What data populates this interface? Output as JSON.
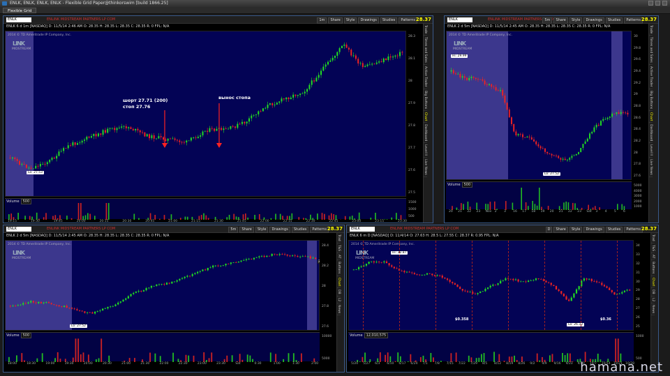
{
  "window": {
    "title": "ENLK, ENLK, ENLK, ENLK - Flexible Grid Paper@thinkorswim [build 1866.25]",
    "tab": "Flexible Grid"
  },
  "common": {
    "btn_share": "Share",
    "btn_style": "Style",
    "btn_drawings": "Drawings",
    "btn_studies": "Studies",
    "btn_patterns": "Patterns",
    "desc": "ENLINK MIDSTREAM PARTNERS LP COM",
    "watermark": "2014 © TD Ameritrade IP Company, Inc.",
    "logo": "LINK",
    "logo_sub": "MIDSTREAM",
    "vol_label": "Volume"
  },
  "panels": [
    {
      "symbol": "ENLK",
      "timeframe": "1m",
      "price": "28.37",
      "info": "ENLK 6 d 1m [NASDAQ]  D: 11/5/14 2:46 AM  O: 28.35  H: 28.35  L: 28.35  C: 28.35  R: 0  FPL: N/A",
      "low_label": "Lo: 27.53",
      "vol_value": "500",
      "xticks": [
        "19:15",
        "19:30",
        "19:45",
        "20:00",
        "20:15",
        "20:30",
        "20:45",
        "21:00",
        "21:15",
        "21:30",
        "21:45",
        "22:00",
        "22:15",
        "22:30",
        "22:45",
        "23:00",
        "23:15",
        "23:30"
      ],
      "yticks": [
        "28.3",
        "28.1",
        "28",
        "27.9",
        "27.8",
        "27.7",
        "27.6",
        "27.5"
      ],
      "vyticks": [
        "1500",
        "1000",
        "500"
      ],
      "sidetabs": [
        "Trade",
        "Times and Sales",
        "Active Trader",
        "Big Buttons",
        "Chart",
        "Dashboard",
        "Level II",
        "Live News"
      ],
      "annotation_short": "шорт 27.71 (200)",
      "annotation_stop": "стоп 27.76",
      "annotation_move": "вынос стопа"
    },
    {
      "symbol": "ENLK",
      "timeframe": "5m",
      "price": "28.37",
      "info": "ENLK 2 d 5m [NASDAQ]  D: 11/5/14 2:45 AM  O: 28.35  H: 28.35  L: 28.35  C: 28.35  R: 0  FPL: N/A",
      "high_label": "Hi: 29.99",
      "low_label": "Lo: 27.52",
      "vol_value": "500",
      "xticks": [
        "20",
        "21",
        "22",
        "23",
        "Nov",
        "2",
        "3",
        "16",
        "17",
        "18",
        "19",
        "20",
        "21",
        "22",
        "23",
        "Sat",
        "3",
        "4",
        "5",
        "6"
      ],
      "yticks": [
        "30",
        "29.8",
        "29.6",
        "29.4",
        "29.2",
        "29",
        "28.8",
        "28.6",
        "28.4",
        "28.2",
        "28",
        "27.8",
        "27.6"
      ],
      "vyticks": [
        "5000",
        "4000",
        "3000",
        "2000",
        "1000"
      ],
      "sidetabs": [
        "Trade",
        "Times and Sales",
        "Active Trader",
        "Big Buttons",
        "Chart",
        "Dashboard",
        "Level II",
        "Live News"
      ]
    },
    {
      "symbol": "ENLK",
      "timeframe": "5m",
      "price": "28.37",
      "info": "ENLK 2 d 5m [NASDAQ]  D: 11/5/14 2:45 AM  O: 28.35  H: 28.35  L: 28.35  C: 28.35  R: 0  FPL: N/A",
      "low_label": "Lo: 27.52",
      "price_tag": "28.35",
      "vol_value": "500",
      "xticks": [
        "18:00",
        "18:30",
        "19:00",
        "19:30",
        "20:00",
        "20:30",
        "21:00",
        "21:30",
        "22:00",
        "22:30",
        "23:00",
        "23:30",
        "Sat",
        "0:30",
        "1:00",
        "1:30",
        "2:00"
      ],
      "yticks": [
        "28.4",
        "28.2",
        "28",
        "27.8",
        "27.6"
      ],
      "vyticks": [
        "10000",
        "5000"
      ],
      "sidetabs": [
        "Trad",
        "T&S",
        "AT",
        "Buttons",
        "Chart",
        "DB",
        "L2",
        "News"
      ]
    },
    {
      "symbol": "ENLK",
      "timeframe": "D",
      "price": "28.37",
      "info": "ENLK 6 m D [NASDAQ]  D: 11/4/14  O: 27.63  H: 28.5  L: 27.55  C: 28.37  R: 0.95  FPL: N/A",
      "high_label": "Hi: 32.87",
      "low_label": "Lo: 26.33",
      "price_tag": "28.37",
      "vol_value": "12,010,575",
      "div1": "$0.358",
      "div2": "$0.36",
      "xticks": [
        "5/20",
        "5/27",
        "6/3",
        "6/10",
        "6/17",
        "6/24",
        "7/1",
        "7/8",
        "7/15",
        "7/22",
        "7/29",
        "8/5",
        "8/12",
        "8/19",
        "8/26",
        "9/2",
        "9/9",
        "9/16",
        "9/23",
        "9/30",
        "10/7",
        "10/14",
        "10/21",
        "10/28"
      ],
      "yticks": [
        "34",
        "33",
        "32",
        "31",
        "30",
        "29",
        "28",
        "27",
        "26",
        "25"
      ],
      "vyticks": [
        "1000",
        "500"
      ],
      "sidetabs": [
        "Trad",
        "T&S",
        "AT",
        "Buttons",
        "Chart",
        "DB",
        "L2",
        "News"
      ]
    }
  ],
  "footer": "hamana.net",
  "chart_data": [
    {
      "type": "candlestick",
      "symbol": "ENLK",
      "timeframe": "1m",
      "high": 28.3,
      "low": 27.53,
      "last": 28.35,
      "annotations": [
        "шорт 27.71 (200)",
        "стоп 27.76",
        "вынос стопа"
      ]
    },
    {
      "type": "candlestick",
      "symbol": "ENLK",
      "timeframe": "5m",
      "high": 29.99,
      "low": 27.52,
      "last": 28.35
    },
    {
      "type": "candlestick",
      "symbol": "ENLK",
      "timeframe": "5m",
      "low": 27.52,
      "last": 28.35
    },
    {
      "type": "candlestick",
      "symbol": "ENLK",
      "timeframe": "D",
      "high": 32.87,
      "low": 26.33,
      "last": 28.37
    }
  ]
}
